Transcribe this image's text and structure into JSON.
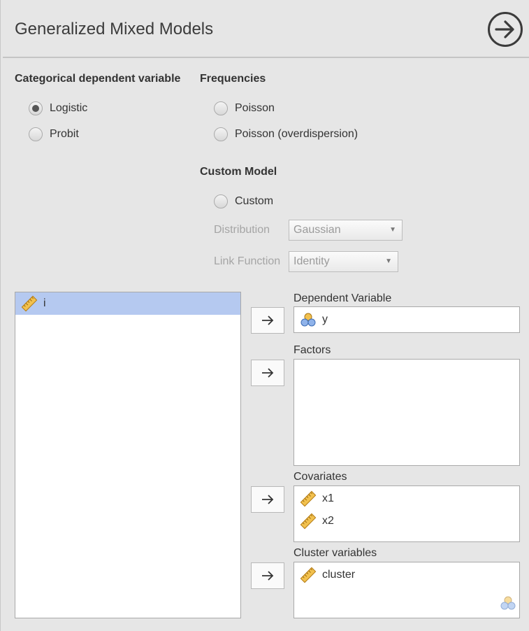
{
  "header": {
    "title": "Generalized Mixed Models"
  },
  "categorical": {
    "heading": "Categorical dependent variable",
    "options": [
      {
        "label": "Logistic",
        "checked": true
      },
      {
        "label": "Probit",
        "checked": false
      }
    ]
  },
  "frequencies": {
    "heading": "Frequencies",
    "options": [
      {
        "label": "Poisson",
        "checked": false
      },
      {
        "label": "Poisson (overdispersion)",
        "checked": false
      }
    ]
  },
  "custom_model": {
    "heading": "Custom Model",
    "custom_label": "Custom",
    "distribution_label": "Distribution",
    "distribution_value": "Gaussian",
    "link_label": "Link Function",
    "link_value": "Identity"
  },
  "source_list": {
    "items": [
      {
        "name": "i",
        "icon": "ruler-icon",
        "selected": true
      }
    ]
  },
  "targets": {
    "dependent": {
      "label": "Dependent Variable",
      "items": [
        {
          "name": "y",
          "icon": "nominal-icon"
        }
      ]
    },
    "factors": {
      "label": "Factors",
      "items": []
    },
    "covariates": {
      "label": "Covariates",
      "items": [
        {
          "name": "x1",
          "icon": "ruler-icon"
        },
        {
          "name": "x2",
          "icon": "ruler-icon"
        }
      ]
    },
    "cluster": {
      "label": "Cluster variables",
      "items": [
        {
          "name": "cluster",
          "icon": "ruler-icon"
        }
      ]
    }
  },
  "colors": {
    "selection": "#b5c9f0",
    "ruler": "#e8a830",
    "background": "#e6e6e6"
  }
}
